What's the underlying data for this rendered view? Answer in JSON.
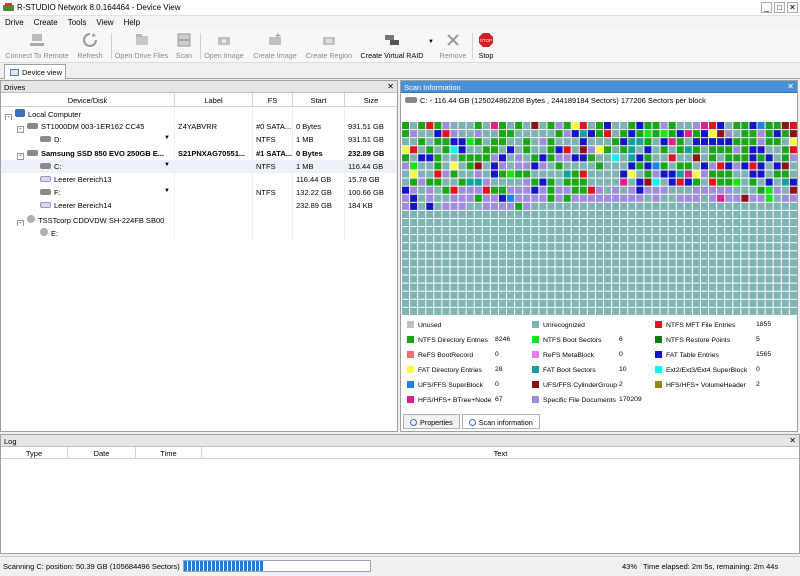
{
  "window": {
    "title": "R-STUDIO Network 8.0.164464 - Device View",
    "buttons": [
      "_",
      "□",
      "✕"
    ]
  },
  "menu": [
    "Drive",
    "Create",
    "Tools",
    "View",
    "Help"
  ],
  "toolbar": [
    {
      "label": "Connect To Remote",
      "icon": "network-icon",
      "enabled": false
    },
    {
      "label": "Refresh",
      "icon": "refresh-icon",
      "enabled": false
    },
    {
      "label": "Open Drive Files",
      "icon": "open-files-icon",
      "enabled": false
    },
    {
      "label": "Scan",
      "icon": "scan-icon",
      "enabled": false
    },
    {
      "label": "Open Image",
      "icon": "open-image-icon",
      "enabled": false
    },
    {
      "label": "Create Image",
      "icon": "create-image-icon",
      "enabled": false
    },
    {
      "label": "Create Region",
      "icon": "create-region-icon",
      "enabled": false
    },
    {
      "label": "Create Virtual RAID",
      "icon": "raid-icon",
      "enabled": true
    },
    {
      "label": "Remove",
      "icon": "remove-icon",
      "enabled": false
    },
    {
      "label": "Stop",
      "icon": "stop-icon",
      "enabled": true
    }
  ],
  "doc_tab": "Device view",
  "drives": {
    "title": "Drives",
    "columns": [
      "Device/Disk",
      "Label",
      "FS",
      "Start",
      "Size"
    ],
    "rows": [
      {
        "name": "Local Computer",
        "label": "",
        "fs": "",
        "start": "",
        "size": "",
        "indent": 0,
        "icon": "computer-icon",
        "expander": "-",
        "bold": false
      },
      {
        "name": "ST1000DM 003-1ER162 CC45",
        "label": "Z4YABVRR",
        "fs": "#0 SATA...",
        "start": "0 Bytes",
        "size": "931.51 GB",
        "indent": 1,
        "icon": "disk-icon",
        "expander": "-",
        "bold": false
      },
      {
        "name": "D:",
        "label": "",
        "fs": "NTFS",
        "start": "1 MB",
        "size": "931.51 GB",
        "indent": 2,
        "icon": "partition-icon",
        "expander": "",
        "bold": false,
        "dropdown": true
      },
      {
        "name": "Samsung SSD 850 EVO 250GB E...",
        "label": "S21PNXAG70551...",
        "fs": "#1 SATA...",
        "start": "0 Bytes",
        "size": "232.89 GB",
        "indent": 1,
        "icon": "disk-icon",
        "expander": "-",
        "bold": true
      },
      {
        "name": "C:",
        "label": "",
        "fs": "NTFS",
        "start": "1 MB",
        "size": "116.44 GB",
        "indent": 2,
        "icon": "partition-icon",
        "expander": "",
        "bold": false,
        "dropdown": true,
        "selected": true
      },
      {
        "name": "Leerer Bereich13",
        "label": "",
        "fs": "",
        "start": "116.44 GB",
        "size": "15.78 GB",
        "indent": 2,
        "icon": "empty-space-icon",
        "expander": "",
        "bold": false
      },
      {
        "name": "F:",
        "label": "",
        "fs": "NTFS",
        "start": "132.22 GB",
        "size": "100.66 GB",
        "indent": 2,
        "icon": "partition-icon",
        "expander": "",
        "bold": false,
        "dropdown": true
      },
      {
        "name": "Leerer Bereich14",
        "label": "",
        "fs": "",
        "start": "232.89 GB",
        "size": "184 KB",
        "indent": 2,
        "icon": "empty-space-icon",
        "expander": "",
        "bold": false
      },
      {
        "name": "TSSTcorp CDDVDW SH-224FB SB00",
        "label": "",
        "fs": "",
        "start": "",
        "size": "",
        "indent": 1,
        "icon": "cdrom-icon",
        "expander": "-",
        "bold": false
      },
      {
        "name": "E:",
        "label": "",
        "fs": "",
        "start": "",
        "size": "",
        "indent": 2,
        "icon": "cdrom-drive-icon",
        "expander": "",
        "bold": false
      }
    ]
  },
  "scan": {
    "title": "Scan Information",
    "info": "C: - 116.44 GB (125024862208 Bytes , 244189184 Sectors) 177206 Sectors per block",
    "scanned_fraction": 0.43,
    "legend": [
      {
        "label": "Unused",
        "count": "",
        "color": "#c0c0c0"
      },
      {
        "label": "Unrecognized",
        "count": "",
        "color": "#7fb2b2"
      },
      {
        "label": "NTFS MFT File Entries",
        "count": "1855",
        "color": "#e0141e"
      },
      {
        "label": "NTFS Directory Entries",
        "count": "8246",
        "color": "#1aa51a"
      },
      {
        "label": "NTFS Boot Sectors",
        "count": "6",
        "color": "#14e614"
      },
      {
        "label": "NTFS Restore Points",
        "count": "5",
        "color": "#147814"
      },
      {
        "label": "ReFS BootRecord",
        "count": "0",
        "color": "#f06e6e"
      },
      {
        "label": "ReFS MetaBlock",
        "count": "0",
        "color": "#f078f0"
      },
      {
        "label": "FAT Table Entries",
        "count": "1565",
        "color": "#1414c8"
      },
      {
        "label": "FAT Directory Entries",
        "count": "28",
        "color": "#fafa46"
      },
      {
        "label": "FAT Boot Sectors",
        "count": "10",
        "color": "#14a0a0"
      },
      {
        "label": "Ext2/Ext3/Ext4 SuperBlock",
        "count": "0",
        "color": "#14f0f0"
      },
      {
        "label": "UFS/FFS SuperBlock",
        "count": "0",
        "color": "#1e82f0"
      },
      {
        "label": "UFS/FFS CylinderGroup",
        "count": "2",
        "color": "#8c1414"
      },
      {
        "label": "HFS/HFS+ VolumeHeader",
        "count": "2",
        "color": "#8c8c14"
      },
      {
        "label": "HFS/HFS+ BTree+Node",
        "count": "67",
        "color": "#e01e8c"
      },
      {
        "label": "Specific File Documents",
        "count": "170209",
        "color": "#a08cdc"
      }
    ],
    "tabs": [
      "Properties",
      "Scan information"
    ]
  },
  "log": {
    "title": "Log",
    "columns": [
      "Type",
      "Date",
      "Time",
      "Text"
    ]
  },
  "status": {
    "text": "Scanning C: position: 50.39 GB (105684496 Sectors)",
    "progress": 0.43,
    "percent": "43%",
    "elapsed": "Time elapsed: 2m 5s, remaining: 2m 44s"
  }
}
